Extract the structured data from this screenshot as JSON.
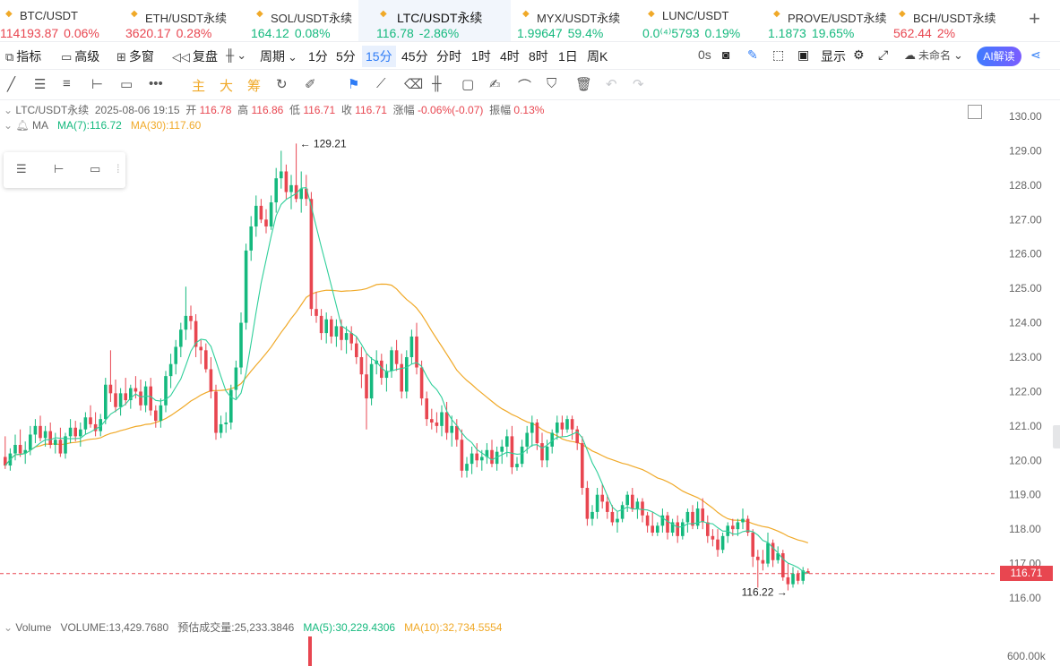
{
  "tabs": [
    {
      "name": "BTC/USDT",
      "price": "114193.87",
      "change": "0.06%",
      "dir": "down"
    },
    {
      "name": "ETH/USDT永续",
      "price": "3620.17",
      "change": "0.28%",
      "dir": "down"
    },
    {
      "name": "SOL/USDT永续",
      "price": "164.12",
      "change": "0.08%",
      "dir": "up"
    },
    {
      "name": "LTC/USDT永续",
      "price": "116.78",
      "change": "-2.86%",
      "dir": "up"
    },
    {
      "name": "MYX/USDT永续",
      "price": "1.99647",
      "change": "59.4%",
      "dir": "up"
    },
    {
      "name": "LUNC/USDT",
      "price": "0.0⁽⁴⁾5793",
      "change": "0.19%",
      "dir": "up"
    },
    {
      "name": "PROVE/USDT永续",
      "price": "1.1873",
      "change": "19.65%",
      "dir": "up"
    },
    {
      "name": "BCH/USDT永续",
      "price": "562.44",
      "change": "2%",
      "dir": "down"
    }
  ],
  "toolbar": {
    "indicators": "指标",
    "advanced": "高级",
    "multi_window": "多窗",
    "replay": "复盘",
    "period": "周期",
    "intervals": [
      "1分",
      "5分",
      "15分",
      "45分",
      "分时",
      "1时",
      "4时",
      "8时",
      "1日",
      "周K"
    ],
    "timer": "0s",
    "display": "显示",
    "unnamed": "未命名",
    "ai": "AI解读"
  },
  "drawtools": {
    "main": "主",
    "big": "大",
    "chips": "筹"
  },
  "legend": {
    "symbol": "LTC/USDT永续",
    "datetime": "2025-08-06 19:15",
    "open_label": "开",
    "open": "116.78",
    "high_label": "高",
    "high": "116.86",
    "low_label": "低",
    "low": "116.71",
    "close_label": "收",
    "close": "116.71",
    "chg_label": "涨幅",
    "chg": "-0.06%(-0.07)",
    "amp_label": "振幅",
    "amp": "0.13%",
    "ma_title": "MA",
    "ma7": "MA(7):116.72",
    "ma30": "MA(30):117.60"
  },
  "volume_legend": {
    "title": "Volume",
    "volume": "VOLUME:13,429.7680",
    "est_label": "预估成交量:",
    "est": "25,233.3846",
    "ma5": "MA(5):30,229.4306",
    "ma10": "MA(10):32,734.5554"
  },
  "price_tag": "116.71",
  "chart_data": {
    "type": "candlestick",
    "y_ticks": [
      "130.00",
      "129.00",
      "128.00",
      "127.00",
      "126.00",
      "125.00",
      "124.00",
      "123.00",
      "122.00",
      "121.00",
      "120.00",
      "119.00",
      "118.00",
      "117.00",
      "116.00"
    ],
    "volume_tick": "600.00k",
    "ylim": [
      116,
      130
    ],
    "last_price": 116.71,
    "max_label": "129.21",
    "min_label": "116.22",
    "colors": {
      "up": "#15b97e",
      "down": "#e84650",
      "ma7": "#2fcf9a",
      "ma30": "#f0a928"
    },
    "candles": [
      [
        120.1,
        120.7,
        119.75,
        119.85
      ],
      [
        119.85,
        120.35,
        119.7,
        120.2
      ],
      [
        120.2,
        120.75,
        120.0,
        120.45
      ],
      [
        120.45,
        120.9,
        120.1,
        120.2
      ],
      [
        120.2,
        120.55,
        119.9,
        120.3
      ],
      [
        120.3,
        121.0,
        120.15,
        120.75
      ],
      [
        120.75,
        121.2,
        120.5,
        121.0
      ],
      [
        121.0,
        121.3,
        120.55,
        120.65
      ],
      [
        120.65,
        121.0,
        120.4,
        120.85
      ],
      [
        120.85,
        121.1,
        120.35,
        120.45
      ],
      [
        120.45,
        120.8,
        120.2,
        120.6
      ],
      [
        120.6,
        120.95,
        120.1,
        120.2
      ],
      [
        120.2,
        120.8,
        120.05,
        120.7
      ],
      [
        120.7,
        121.2,
        120.5,
        120.95
      ],
      [
        120.95,
        121.15,
        120.55,
        120.7
      ],
      [
        120.7,
        121.1,
        120.4,
        120.9
      ],
      [
        120.9,
        121.4,
        120.75,
        121.25
      ],
      [
        121.25,
        121.6,
        120.95,
        121.05
      ],
      [
        121.05,
        121.4,
        120.7,
        120.85
      ],
      [
        120.85,
        121.35,
        120.7,
        121.2
      ],
      [
        121.2,
        122.4,
        121.05,
        122.2
      ],
      [
        122.2,
        123.2,
        121.7,
        121.95
      ],
      [
        121.95,
        122.35,
        121.4,
        121.55
      ],
      [
        121.55,
        122.1,
        121.3,
        121.95
      ],
      [
        121.95,
        122.4,
        121.6,
        121.75
      ],
      [
        121.75,
        122.2,
        121.5,
        122.1
      ],
      [
        122.1,
        122.45,
        121.8,
        122.0
      ],
      [
        122.0,
        122.35,
        121.45,
        121.6
      ],
      [
        121.6,
        122.3,
        121.4,
        122.15
      ],
      [
        122.15,
        122.4,
        121.3,
        121.45
      ],
      [
        121.45,
        121.6,
        120.95,
        121.15
      ],
      [
        121.15,
        121.8,
        120.95,
        121.6
      ],
      [
        121.6,
        122.6,
        121.4,
        122.45
      ],
      [
        122.45,
        123.1,
        122.1,
        122.8
      ],
      [
        122.8,
        123.5,
        122.5,
        123.3
      ],
      [
        123.3,
        124.0,
        123.0,
        123.8
      ],
      [
        123.8,
        125.05,
        123.5,
        124.2
      ],
      [
        124.2,
        124.5,
        123.8,
        124.05
      ],
      [
        124.05,
        124.25,
        123.0,
        123.3
      ],
      [
        123.3,
        123.5,
        122.8,
        123.2
      ],
      [
        123.2,
        123.4,
        122.55,
        122.65
      ],
      [
        122.65,
        123.0,
        121.8,
        122.0
      ],
      [
        122.0,
        122.2,
        120.6,
        120.8
      ],
      [
        120.8,
        121.3,
        120.65,
        121.05
      ],
      [
        121.05,
        121.4,
        120.8,
        121.1
      ],
      [
        121.1,
        122.2,
        120.9,
        122.05
      ],
      [
        122.05,
        122.9,
        121.8,
        122.7
      ],
      [
        122.7,
        124.3,
        122.5,
        124.0
      ],
      [
        124.0,
        126.3,
        123.8,
        126.1
      ],
      [
        126.1,
        127.1,
        125.8,
        126.8
      ],
      [
        126.8,
        127.7,
        126.5,
        127.4
      ],
      [
        127.4,
        127.6,
        126.9,
        127.0
      ],
      [
        127.0,
        127.3,
        126.6,
        126.8
      ],
      [
        126.8,
        127.7,
        126.7,
        127.5
      ],
      [
        127.5,
        128.5,
        127.2,
        128.2
      ],
      [
        128.2,
        129.0,
        127.9,
        128.4
      ],
      [
        128.4,
        128.6,
        127.6,
        127.8
      ],
      [
        127.8,
        128.3,
        127.3,
        128.0
      ],
      [
        128.0,
        129.21,
        127.5,
        127.6
      ],
      [
        127.6,
        128.4,
        127.2,
        127.9
      ],
      [
        127.9,
        128.3,
        127.4,
        127.6
      ],
      [
        127.6,
        127.8,
        124.2,
        124.4
      ],
      [
        124.4,
        124.9,
        124.0,
        124.2
      ],
      [
        124.2,
        124.4,
        123.5,
        123.7
      ],
      [
        123.7,
        124.3,
        123.4,
        124.1
      ],
      [
        124.1,
        124.2,
        123.4,
        123.6
      ],
      [
        123.6,
        124.1,
        123.3,
        123.9
      ],
      [
        123.9,
        124.1,
        123.2,
        123.5
      ],
      [
        123.5,
        123.9,
        123.1,
        123.7
      ],
      [
        123.7,
        123.9,
        123.2,
        123.4
      ],
      [
        123.4,
        123.6,
        122.8,
        123.0
      ],
      [
        123.0,
        123.3,
        122.1,
        122.5
      ],
      [
        122.5,
        123.1,
        120.9,
        121.8
      ],
      [
        121.8,
        123.0,
        121.6,
        122.8
      ],
      [
        122.8,
        123.2,
        122.5,
        122.9
      ],
      [
        122.9,
        123.1,
        122.2,
        122.4
      ],
      [
        122.4,
        122.8,
        122.0,
        122.6
      ],
      [
        122.6,
        123.3,
        122.4,
        123.2
      ],
      [
        123.2,
        123.5,
        122.6,
        122.8
      ],
      [
        122.8,
        123.1,
        121.8,
        122.0
      ],
      [
        122.0,
        123.2,
        121.8,
        123.0
      ],
      [
        123.0,
        123.8,
        122.8,
        123.6
      ],
      [
        123.6,
        124.0,
        122.5,
        122.7
      ],
      [
        122.7,
        122.9,
        121.6,
        121.8
      ],
      [
        121.8,
        122.0,
        121.0,
        121.2
      ],
      [
        121.2,
        121.5,
        120.9,
        121.1
      ],
      [
        121.1,
        121.4,
        120.8,
        121.0
      ],
      [
        121.0,
        121.6,
        120.7,
        121.4
      ],
      [
        121.4,
        121.7,
        120.6,
        120.8
      ],
      [
        120.8,
        121.3,
        120.4,
        121.0
      ],
      [
        121.0,
        121.2,
        120.4,
        120.6
      ],
      [
        120.6,
        120.9,
        119.5,
        119.7
      ],
      [
        119.7,
        120.1,
        119.5,
        119.9
      ],
      [
        119.9,
        120.4,
        119.6,
        120.2
      ],
      [
        120.2,
        120.5,
        119.8,
        120.0
      ],
      [
        120.0,
        120.3,
        119.7,
        120.1
      ],
      [
        120.1,
        120.5,
        119.9,
        120.3
      ],
      [
        120.3,
        120.6,
        119.8,
        119.9
      ],
      [
        119.9,
        120.4,
        119.7,
        120.25
      ],
      [
        120.25,
        120.6,
        119.9,
        120.4
      ],
      [
        120.4,
        120.9,
        120.1,
        120.7
      ],
      [
        120.7,
        121.0,
        119.6,
        119.8
      ],
      [
        119.8,
        120.1,
        119.7,
        119.9
      ],
      [
        119.9,
        120.6,
        119.8,
        120.4
      ],
      [
        120.4,
        121.0,
        120.2,
        120.8
      ],
      [
        120.8,
        121.3,
        120.4,
        121.1
      ],
      [
        121.1,
        121.2,
        120.3,
        120.5
      ],
      [
        120.5,
        120.8,
        119.8,
        120.0
      ],
      [
        120.0,
        120.6,
        119.8,
        120.4
      ],
      [
        120.4,
        120.9,
        120.2,
        120.8
      ],
      [
        120.8,
        121.3,
        120.6,
        121.1
      ],
      [
        121.1,
        121.3,
        120.7,
        120.9
      ],
      [
        120.9,
        121.3,
        120.8,
        121.2
      ],
      [
        121.2,
        121.3,
        120.6,
        120.9
      ],
      [
        120.9,
        121.0,
        120.3,
        120.5
      ],
      [
        120.5,
        120.7,
        119.0,
        119.2
      ],
      [
        119.2,
        119.4,
        118.1,
        118.3
      ],
      [
        118.3,
        118.7,
        118.1,
        118.5
      ],
      [
        118.5,
        119.2,
        118.3,
        119.0
      ],
      [
        119.0,
        119.3,
        118.6,
        118.8
      ],
      [
        118.8,
        119.0,
        118.3,
        118.5
      ],
      [
        118.5,
        118.7,
        118.1,
        118.2
      ],
      [
        118.2,
        118.5,
        117.9,
        118.3
      ],
      [
        118.3,
        118.8,
        118.2,
        118.7
      ],
      [
        118.7,
        119.1,
        118.5,
        119.0
      ],
      [
        119.0,
        119.2,
        118.5,
        118.6
      ],
      [
        118.6,
        118.9,
        118.3,
        118.8
      ],
      [
        118.8,
        118.9,
        118.2,
        118.4
      ],
      [
        118.4,
        118.5,
        117.9,
        118.1
      ],
      [
        118.1,
        118.5,
        117.8,
        117.9
      ],
      [
        117.9,
        118.2,
        117.8,
        118.1
      ],
      [
        118.1,
        118.6,
        117.9,
        118.4
      ],
      [
        118.4,
        118.5,
        117.7,
        117.9
      ],
      [
        117.9,
        118.3,
        117.8,
        118.2
      ],
      [
        118.2,
        118.4,
        117.6,
        117.8
      ],
      [
        117.8,
        118.3,
        117.7,
        118.2
      ],
      [
        118.2,
        118.6,
        117.9,
        118.5
      ],
      [
        118.5,
        118.7,
        118.0,
        118.1
      ],
      [
        118.1,
        118.8,
        118.0,
        118.6
      ],
      [
        118.6,
        118.9,
        118.0,
        118.2
      ],
      [
        118.2,
        118.4,
        117.6,
        117.8
      ],
      [
        117.8,
        118.0,
        117.5,
        117.7
      ],
      [
        117.7,
        118.0,
        117.2,
        117.4
      ],
      [
        117.4,
        117.9,
        117.3,
        117.8
      ],
      [
        117.8,
        118.2,
        117.6,
        118.1
      ],
      [
        118.1,
        118.3,
        117.8,
        118.0
      ],
      [
        118.0,
        118.3,
        117.8,
        118.2
      ],
      [
        118.2,
        118.6,
        118.0,
        118.3
      ],
      [
        118.3,
        118.4,
        117.8,
        117.9
      ],
      [
        117.9,
        118.0,
        116.9,
        117.2
      ],
      [
        117.2,
        117.4,
        116.3,
        117.1
      ],
      [
        117.1,
        117.4,
        116.8,
        117.0
      ],
      [
        117.0,
        117.9,
        116.9,
        117.6
      ],
      [
        117.6,
        117.7,
        116.9,
        117.1
      ],
      [
        117.1,
        117.5,
        117.0,
        117.3
      ],
      [
        117.3,
        117.4,
        116.5,
        116.6
      ],
      [
        116.6,
        117.0,
        116.22,
        116.4
      ],
      [
        116.4,
        116.9,
        116.3,
        116.7
      ],
      [
        116.7,
        116.8,
        116.4,
        116.5
      ],
      [
        116.5,
        116.9,
        116.4,
        116.8
      ],
      [
        116.78,
        116.86,
        116.71,
        116.71
      ]
    ]
  }
}
